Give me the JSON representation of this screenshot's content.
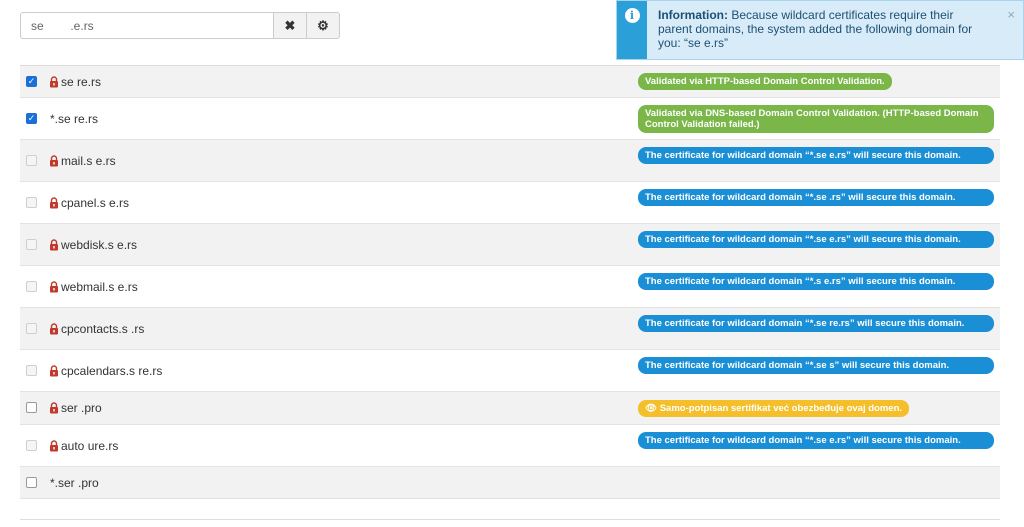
{
  "search": {
    "value": "se        .e.rs",
    "clear_icon": "✖",
    "settings_icon": "⚙"
  },
  "toast": {
    "title": "Information:",
    "message": " Because wildcard certificates require their parent domains, the system added the following domain for you: “se                 e.rs”",
    "close": "×"
  },
  "rows": [
    {
      "checkbox": "checked",
      "lock": true,
      "domain": "se               re.rs",
      "badge": {
        "type": "green",
        "text": "Validated via HTTP-based Domain Control Validation."
      }
    },
    {
      "checkbox": "checked",
      "lock": false,
      "domain": "*.se                 re.rs",
      "badge": {
        "type": "green",
        "text": "Validated via DNS-based Domain Control Validation. (HTTP-based Domain Control Validation failed.)"
      }
    },
    {
      "checkbox": "disabled",
      "lock": true,
      "domain": "mail.s                        e.rs",
      "badge": {
        "type": "blue",
        "text": "The certificate for wildcard domain “*.se                          e.rs” will secure this domain."
      }
    },
    {
      "checkbox": "disabled",
      "lock": true,
      "domain": "cpanel.s                     e.rs",
      "badge": {
        "type": "blue",
        "text": "The certificate for wildcard domain “*.se                           .rs” will secure this domain."
      }
    },
    {
      "checkbox": "disabled",
      "lock": true,
      "domain": "webdisk.s                   e.rs",
      "badge": {
        "type": "blue",
        "text": "The certificate for wildcard domain “*.se                           e.rs” will secure this domain."
      }
    },
    {
      "checkbox": "disabled",
      "lock": true,
      "domain": "webmail.s                  e.rs",
      "badge": {
        "type": "blue",
        "text": "The certificate for wildcard domain “*.s                             e.rs” will secure this domain."
      }
    },
    {
      "checkbox": "disabled",
      "lock": true,
      "domain": "cpcontacts.s                .rs",
      "badge": {
        "type": "blue",
        "text": "The certificate for wildcard domain “*.se                           re.rs” will secure this domain."
      }
    },
    {
      "checkbox": "disabled",
      "lock": true,
      "domain": "cpcalendars.s              re.rs",
      "badge": {
        "type": "blue",
        "text": "The certificate for wildcard domain “*.se                            s” will secure this domain."
      }
    },
    {
      "checkbox": "unchecked",
      "lock": true,
      "domain": "ser                          .pro",
      "badge": {
        "type": "yellow",
        "text": "👁 Samo-potpisan sertifikat već obezbeđuje ovaj domen."
      }
    },
    {
      "checkbox": "disabled",
      "lock": true,
      "domain": "auto                        ure.rs",
      "badge": {
        "type": "blue",
        "text": "The certificate for wildcard domain “*.se                           e.rs” will secure this domain."
      }
    },
    {
      "checkbox": "unchecked",
      "lock": false,
      "domain": "*.ser                          .pro",
      "badge": null
    }
  ],
  "colors": {
    "green": "#7ab648",
    "blue": "#1a8fd6",
    "yellow": "#f4bf2a",
    "info": "#2a9fd8"
  }
}
